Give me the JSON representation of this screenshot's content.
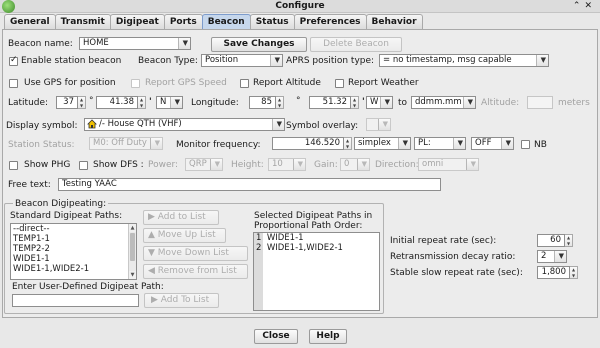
{
  "window": {
    "title": "Configure",
    "controls": [
      "⌃",
      "✕"
    ]
  },
  "tabs": [
    "General",
    "Transmit",
    "Digipeat",
    "Ports",
    "Beacon",
    "Status",
    "Preferences",
    "Behavior"
  ],
  "active_tab": "Beacon",
  "beacon": {
    "name_label": "Beacon name:",
    "name_value": "HOME",
    "save_changes": "Save Changes",
    "delete_beacon": "Delete Beacon",
    "enable_label": "Enable station beacon",
    "enable_checked": true,
    "beacon_type_label": "Beacon Type:",
    "beacon_type_value": "Position",
    "aprs_pos_type_label": "APRS position type:",
    "aprs_pos_type_value": "= no timestamp, msg capable",
    "use_gps_label": "Use GPS for position",
    "report_gps_speed_label": "Report GPS Speed",
    "report_altitude_label": "Report Altitude",
    "report_weather_label": "Report Weather",
    "latitude_label": "Latitude:",
    "lat_deg": "37",
    "lat_min": "41.38",
    "lat_hemi": "N",
    "longitude_label": "Longitude:",
    "lon_deg": "85",
    "lon_min": "51.32",
    "lon_hemi": "W",
    "to_label": "to",
    "coord_format": "ddmm.mm",
    "altitude_label": "Altitude:",
    "altitude_value": "",
    "meters_label": "meters",
    "display_symbol_label": "Display symbol:",
    "display_symbol_value": "/-  House QTH (VHF)",
    "symbol_overlay_label": "Symbol overlay:",
    "symbol_overlay_value": "",
    "station_status_label": "Station Status:",
    "station_status_value": "M0: Off Duty",
    "monitor_freq_label": "Monitor frequency:",
    "monitor_freq_value": "146.520",
    "duplex_value": "simplex",
    "pl_value": "PL:",
    "off_value": "OFF",
    "nb_label": "NB",
    "show_phg_label": "Show PHG",
    "show_dfs_label": "Show DFS :",
    "power_label": "Power:",
    "power_value": "QRP",
    "height_label": "Height:",
    "height_value": "10",
    "gain_label": "Gain:",
    "gain_value": "0",
    "direction_label": "Direction:",
    "direction_value": "omni",
    "free_text_label": "Free text:",
    "free_text_value": "Testing YAAC"
  },
  "digipeating": {
    "group_title": "Beacon Digipeating:",
    "standard_paths_label": "Standard Digipeat Paths:",
    "standard_paths": [
      "--direct--",
      "TEMP1-1",
      "TEMP2-2",
      "WIDE1-1",
      "WIDE1-1,WIDE2-1"
    ],
    "add_to_list": "Add to List",
    "move_up_list": "Move Up List",
    "move_down_list": "Move Down List",
    "remove_from_list": "Remove from List",
    "selected_paths_label_1": "Selected Digipeat Paths in",
    "selected_paths_label_2": "Proportional Path Order:",
    "selected_paths": [
      {
        "n": "1",
        "path": "WIDE1-1"
      },
      {
        "n": "2",
        "path": "WIDE1-1,WIDE2-1"
      }
    ],
    "user_defined_label": "Enter User-Defined Digipeat Path:",
    "user_defined_value": "",
    "add_to_list_2": "Add To List"
  },
  "repeat": {
    "initial_label": "Initial repeat rate (sec):",
    "initial_value": "60",
    "decay_label": "Retransmission decay ratio:",
    "decay_value": "2",
    "slow_label": "Stable slow repeat rate (sec):",
    "slow_value": "1,800"
  },
  "footer": {
    "close": "Close",
    "help": "Help"
  }
}
